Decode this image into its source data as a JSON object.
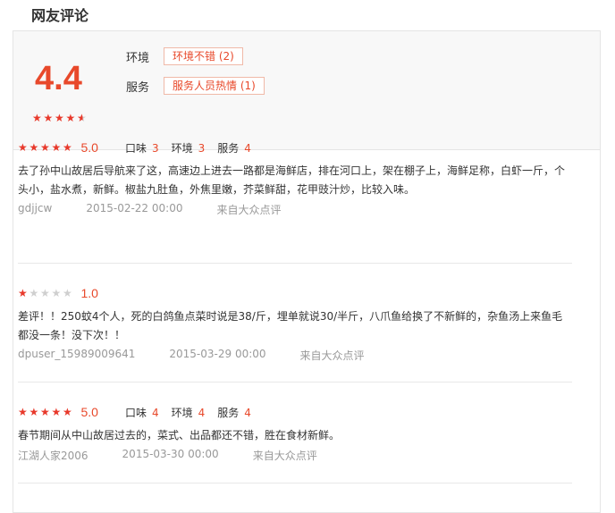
{
  "section_title": "网友评论",
  "summary": {
    "score": "4.4",
    "stars": 4.5,
    "tags": [
      {
        "label": "环境",
        "tag": "环境不错 (2)"
      },
      {
        "label": "服务",
        "tag": "服务人员热情 (1)"
      }
    ]
  },
  "reviews": [
    {
      "stars": 5,
      "score": "5.0",
      "subscores": [
        {
          "label": "口味",
          "value": "3"
        },
        {
          "label": "环境",
          "value": "3"
        },
        {
          "label": "服务",
          "value": "4"
        }
      ],
      "text": "去了孙中山故居后导航来了这，高速边上进去一路都是海鲜店，排在河口上，架在棚子上，海鲜足称，白虾一斤，个头小，盐水煮，新鲜。椒盐九肚鱼，外焦里嫩，芥菜鲜甜，花甲豉汁炒，比较入味。",
      "user": "gdjjcw",
      "date": "2015-02-22 00:00",
      "source": "来自大众点评"
    },
    {
      "stars": 1,
      "score": "1.0",
      "subscores": [],
      "text": "差评！！250蚊4个人，死的白鸽鱼点菜时说是38/斤，埋单就说30/半斤，八爪鱼给换了不新鲜的，杂鱼汤上来鱼毛都没一条！没下次！！",
      "user": "dpuser_15989009641",
      "date": "2015-03-29 00:00",
      "source": "来自大众点评"
    },
    {
      "stars": 5,
      "score": "5.0",
      "subscores": [
        {
          "label": "口味",
          "value": "4"
        },
        {
          "label": "环境",
          "value": "4"
        },
        {
          "label": "服务",
          "value": "4"
        }
      ],
      "text": "春节期间从中山故居过去的，菜式、出品都还不错，胜在食材新鲜。",
      "user": "江湖人家2006",
      "date": "2015-03-30 00:00",
      "source": "来自大众点评"
    }
  ]
}
